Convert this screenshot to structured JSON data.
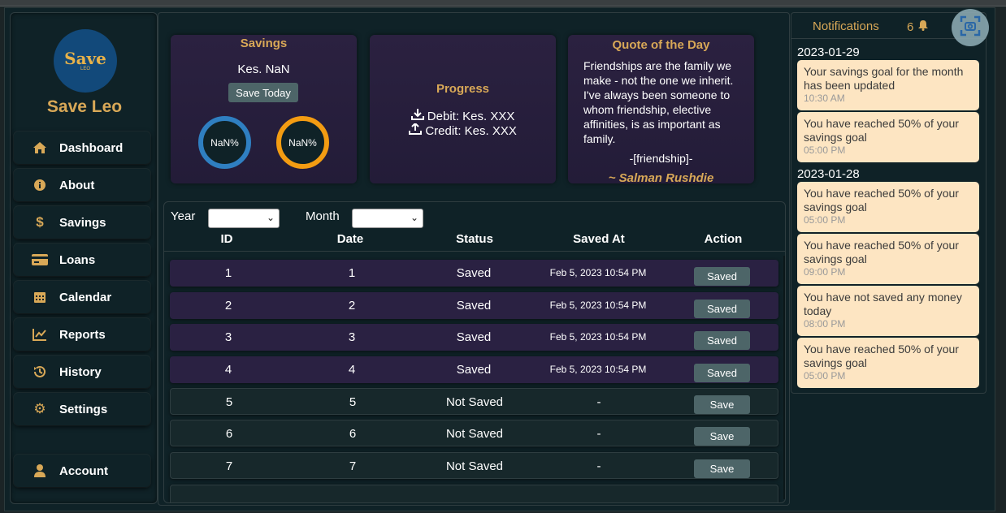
{
  "app": {
    "name": "Save Leo",
    "logo_text": "Save",
    "logo_sub": "LEO"
  },
  "sidebar": {
    "items": [
      {
        "label": "Dashboard",
        "icon": "home-icon"
      },
      {
        "label": "About",
        "icon": "info-icon"
      },
      {
        "label": "Savings",
        "icon": "dollar-icon"
      },
      {
        "label": "Loans",
        "icon": "card-icon"
      },
      {
        "label": "Calendar",
        "icon": "calendar-icon"
      },
      {
        "label": "Reports",
        "icon": "chart-line-icon"
      },
      {
        "label": "History",
        "icon": "history-icon"
      },
      {
        "label": "Settings",
        "icon": "gear-icon"
      }
    ],
    "account": {
      "label": "Account",
      "icon": "user-icon"
    }
  },
  "savings_card": {
    "title": "Savings",
    "amount": "Kes. NaN",
    "button": "Save Today",
    "ring1": "NaN%",
    "ring2": "NaN%",
    "ring1_color": "#2f7fc1",
    "ring2_color": "#f39c12"
  },
  "progress_card": {
    "title": "Progress",
    "debit": "Debit: Kes. XXX",
    "credit": "Credit: Kes. XXX"
  },
  "quote_card": {
    "title": "Quote of the Day",
    "text": "Friendships are the family we make - not the one we inherit. I've always been someone to whom friendship, elective affinities, is as important as family.",
    "tag": "-[friendship]-",
    "author": "~ Salman Rushdie"
  },
  "filters": {
    "year_label": "Year",
    "month_label": "Month"
  },
  "table": {
    "headers": [
      "ID",
      "Date",
      "Status",
      "Saved At",
      "Action"
    ],
    "rows": [
      {
        "id": "1",
        "date": "1",
        "status": "Saved",
        "saved_at": "Feb 5, 2023 10:54 PM",
        "action": "Saved"
      },
      {
        "id": "2",
        "date": "2",
        "status": "Saved",
        "saved_at": "Feb 5, 2023 10:54 PM",
        "action": "Saved"
      },
      {
        "id": "3",
        "date": "3",
        "status": "Saved",
        "saved_at": "Feb 5, 2023 10:54 PM",
        "action": "Saved"
      },
      {
        "id": "4",
        "date": "4",
        "status": "Saved",
        "saved_at": "Feb 5, 2023 10:54 PM",
        "action": "Saved"
      },
      {
        "id": "5",
        "date": "5",
        "status": "Not Saved",
        "saved_at": "-",
        "action": "Save"
      },
      {
        "id": "6",
        "date": "6",
        "status": "Not Saved",
        "saved_at": "-",
        "action": "Save"
      },
      {
        "id": "7",
        "date": "7",
        "status": "Not Saved",
        "saved_at": "-",
        "action": "Save"
      }
    ]
  },
  "notifications": {
    "title": "Notifications",
    "count": "6",
    "groups": [
      {
        "date": "2023-01-29",
        "items": [
          {
            "message": "Your savings goal for the month has been updated",
            "time": "10:30 AM"
          },
          {
            "message": "You have reached 50% of your savings goal",
            "time": "05:00 PM"
          }
        ]
      },
      {
        "date": "2023-01-28",
        "items": [
          {
            "message": "You have reached 50% of your savings goal",
            "time": "05:00 PM"
          },
          {
            "message": "You have reached 50% of your savings goal",
            "time": "09:00 PM"
          },
          {
            "message": "You have not saved any money today",
            "time": "08:00 PM"
          },
          {
            "message": "You have reached 50% of your savings goal",
            "time": "05:00 PM"
          }
        ]
      }
    ]
  },
  "colors": {
    "accent": "#d8a857",
    "card_purple": "#2a2142",
    "button": "#4d6568",
    "notif_bg": "#fde5c2"
  }
}
